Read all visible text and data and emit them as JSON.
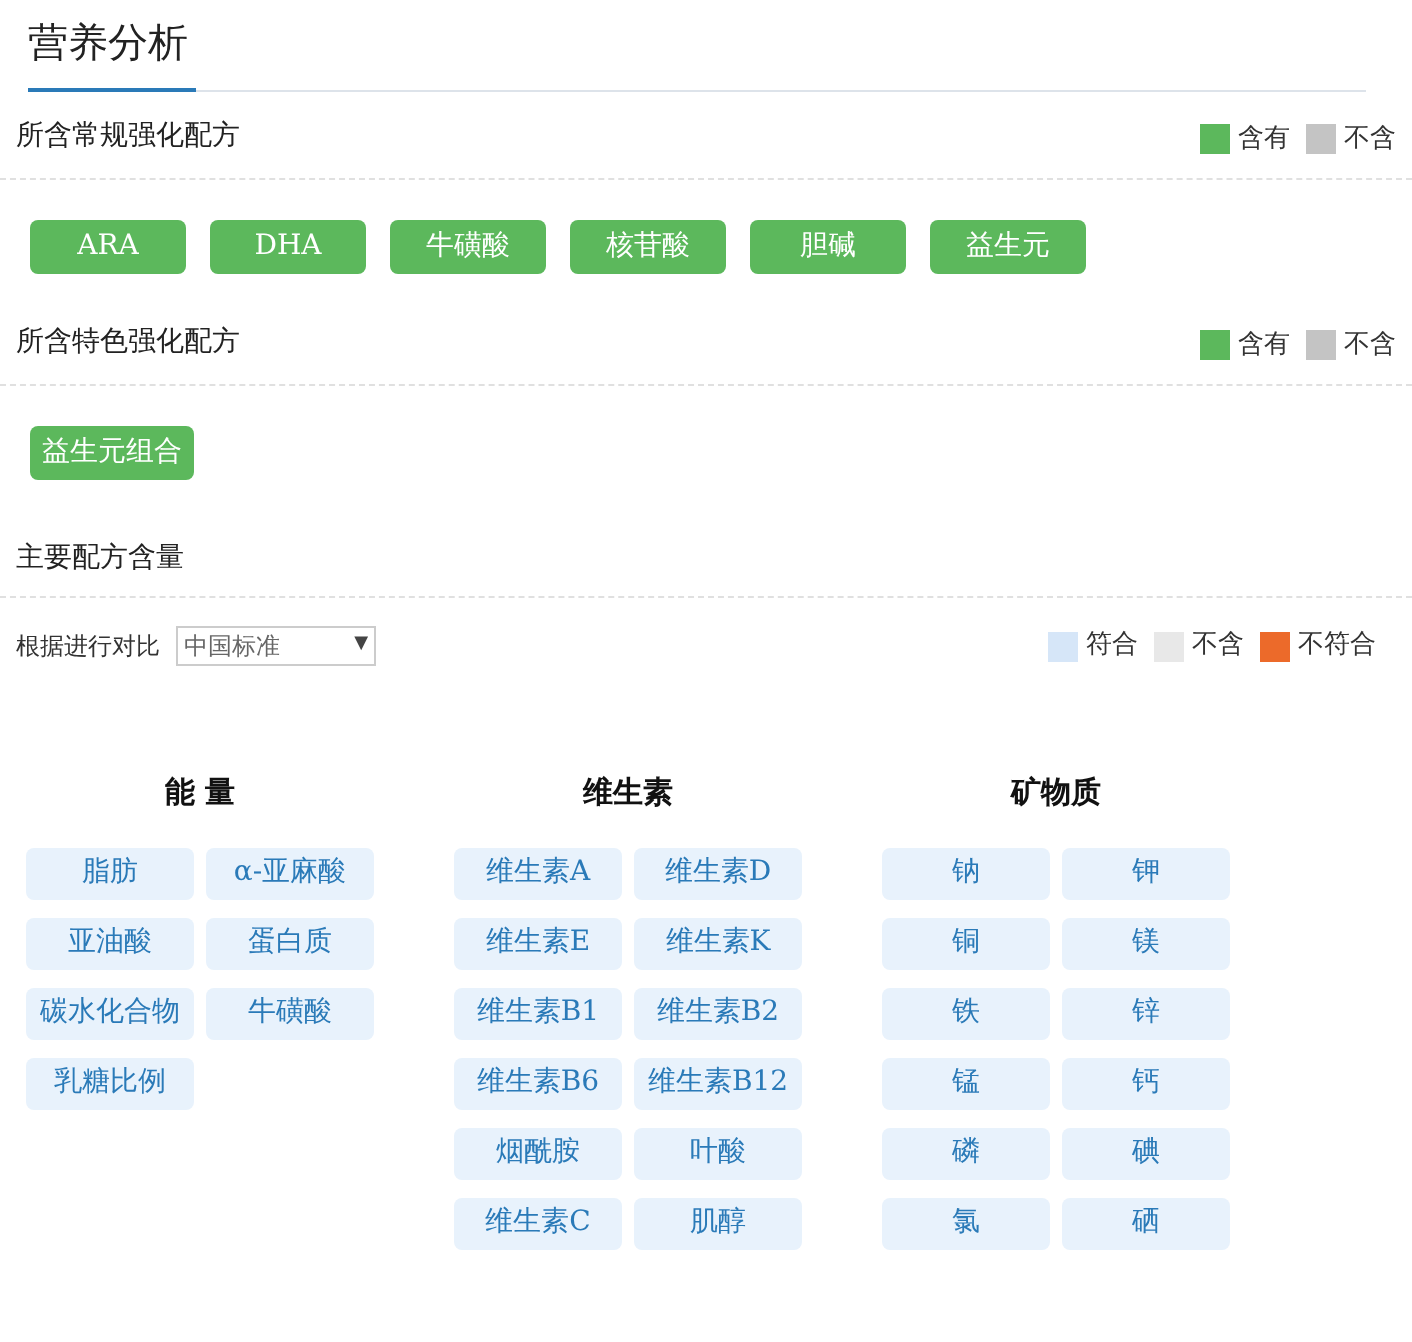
{
  "title": "营养分析",
  "regular": {
    "heading": "所含常规强化配方",
    "legend": [
      {
        "label": "含有",
        "color": "#5cb85c"
      },
      {
        "label": "不含",
        "color": "#c4c4c4"
      }
    ],
    "items": [
      {
        "label": "ARA",
        "included": true
      },
      {
        "label": "DHA",
        "included": true
      },
      {
        "label": "牛磺酸",
        "included": true
      },
      {
        "label": "核苷酸",
        "included": true
      },
      {
        "label": "胆碱",
        "included": true
      },
      {
        "label": "益生元",
        "included": true
      }
    ]
  },
  "special": {
    "heading": "所含特色强化配方",
    "legend": [
      {
        "label": "含有",
        "color": "#5cb85c"
      },
      {
        "label": "不含",
        "color": "#c4c4c4"
      }
    ],
    "items": [
      {
        "label": "益生元组合",
        "included": true
      }
    ]
  },
  "main": {
    "heading": "主要配方含量",
    "compare_label": "根据进行对比",
    "standard": {
      "value": "中国标准",
      "arrow": "▼"
    },
    "legend": [
      {
        "label": "符合",
        "color": "#d6e6f8"
      },
      {
        "label": "不含",
        "color": "#e8e8e8"
      },
      {
        "label": "不符合",
        "color": "#ec6a2a"
      }
    ],
    "groups": [
      {
        "title": "能 量",
        "items": [
          {
            "label": "脂肪",
            "conforms": true
          },
          {
            "label": "α-亚麻酸",
            "conforms": true
          },
          {
            "label": "亚油酸",
            "conforms": true
          },
          {
            "label": "蛋白质",
            "conforms": true
          },
          {
            "label": "碳水化合物",
            "conforms": true
          },
          {
            "label": "牛磺酸",
            "conforms": true
          },
          {
            "label": "乳糖比例",
            "conforms": true
          }
        ]
      },
      {
        "title": "维生素",
        "items": [
          {
            "label": "维生素A",
            "conforms": true
          },
          {
            "label": "维生素D",
            "conforms": true
          },
          {
            "label": "维生素E",
            "conforms": true
          },
          {
            "label": "维生素K",
            "conforms": true
          },
          {
            "label": "维生素B1",
            "conforms": true
          },
          {
            "label": "维生素B2",
            "conforms": true
          },
          {
            "label": "维生素B6",
            "conforms": true
          },
          {
            "label": "维生素B12",
            "conforms": true
          },
          {
            "label": "烟酰胺",
            "conforms": true
          },
          {
            "label": "叶酸",
            "conforms": true
          },
          {
            "label": "维生素C",
            "conforms": true
          },
          {
            "label": "肌醇",
            "conforms": true
          }
        ]
      },
      {
        "title": "矿物质",
        "items": [
          {
            "label": "钠",
            "conforms": true
          },
          {
            "label": "钾",
            "conforms": true
          },
          {
            "label": "铜",
            "conforms": true
          },
          {
            "label": "镁",
            "conforms": true
          },
          {
            "label": "铁",
            "conforms": true
          },
          {
            "label": "锌",
            "conforms": true
          },
          {
            "label": "锰",
            "conforms": true
          },
          {
            "label": "钙",
            "conforms": true
          },
          {
            "label": "磷",
            "conforms": true
          },
          {
            "label": "碘",
            "conforms": true
          },
          {
            "label": "氯",
            "conforms": true
          },
          {
            "label": "硒",
            "conforms": true
          }
        ]
      }
    ]
  }
}
